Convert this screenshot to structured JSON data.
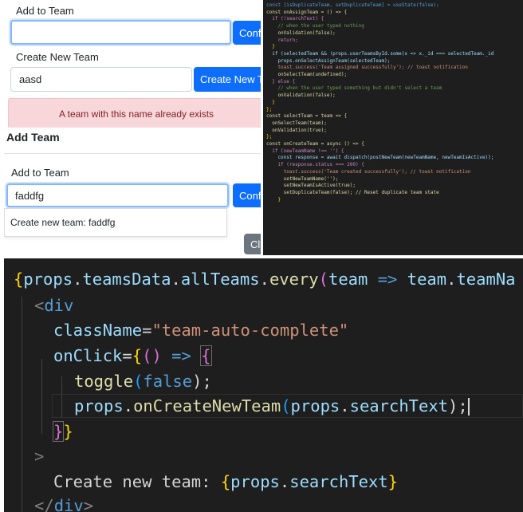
{
  "panel1": {
    "add_to_team_label": "Add to Team",
    "add_to_team_value": "",
    "confirm_label": "Confi",
    "create_new_team_label": "Create New Team",
    "create_new_team_value": "aasd",
    "create_new_team_button": "Create New Te",
    "alert_text": "A team with this name already exists",
    "colors": {
      "primary": "#0d6efd",
      "danger_bg": "#f8d7da",
      "danger_text": "#842029"
    }
  },
  "panel2": {
    "title": "Add Team",
    "add_to_team_label": "Add to Team",
    "input_value": "faddfg",
    "confirm_label": "Conf",
    "dropdown_item": "Create new team: faddfg",
    "close_button": "Cl"
  },
  "small_code": {
    "lines": [
      "const [isDuplicateTeam, setDuplicateTeam] = useState(false);",
      "",
      "const onAssignTeam = () => {",
      "  if (!searchText) {",
      "    // when the user typed nothing",
      "    onValidation(false);",
      "    return;",
      "  }",
      "  if (selectedTeam && !props.userTeamsById.some(x => x._id === selectedTeam._id",
      "    props.onSelectAssignTeam(selectedTeam);",
      "    toast.success('Team assigned successfully'); // toast notification",
      "    onSelectTeam(undefined);",
      "  } else {",
      "    // when the user typed something but didn't select a team",
      "    onValidation(false);",
      "  }",
      "};",
      "",
      "const selectTeam = team => {",
      "  onSelectTeam(team);",
      "  onValidation(true);",
      "};",
      "",
      "const onCreateTeam = async () => {",
      "  if (newTeamName !== '') {",
      "    const response = await dispatch(postNewTeam(newTeamName, newTeamIsActive));",
      "",
      "    if (response.status === 200) {",
      "      toast.success('Team created successfully'); // toast notification",
      "      setNewTeamName('');",
      "      setNewTeamIsActive(true);",
      "      setDuplicateTeam(false); // Reset duplicate team state",
      "    }"
    ]
  },
  "large_code": {
    "line1": [
      "{",
      "props",
      ".",
      "teamsData",
      ".",
      "allTeams",
      ".",
      "every",
      "(",
      "team",
      " => ",
      "team",
      ".",
      "teamNa"
    ],
    "line2": [
      "<",
      "div"
    ],
    "line3": [
      "className",
      "=",
      "\"team-auto-complete\""
    ],
    "line4": [
      "onClick",
      "=",
      "{",
      "(",
      ")",
      " => ",
      "{"
    ],
    "line5": [
      "toggle",
      "(",
      "false",
      ");"
    ],
    "line6": [
      "props",
      ".",
      "onCreateNewTeam",
      "(",
      "props",
      ".",
      "searchText",
      ");"
    ],
    "line7": [
      "}",
      "}"
    ],
    "line8": [
      ">"
    ],
    "line9": [
      "Create new team: ",
      "{",
      "props",
      ".",
      "searchText",
      "}"
    ],
    "line10": [
      "</",
      "div",
      ">"
    ]
  },
  "icons": {
    "fold_chevron": "chevron-right-icon",
    "caret": "text-cursor"
  }
}
